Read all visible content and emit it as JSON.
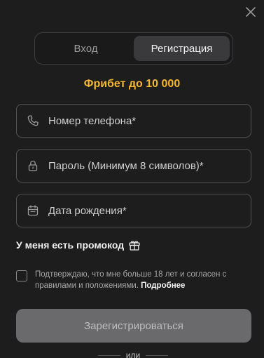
{
  "tabs": [
    {
      "label": "Вход",
      "active": false
    },
    {
      "label": "Регистрация",
      "active": true
    }
  ],
  "bonus": {
    "text": "Фрибет до 10 000",
    "color": "#f5b730"
  },
  "fields": {
    "phone": {
      "placeholder": "Номер телефона*",
      "icon": "phone-icon"
    },
    "password": {
      "placeholder": "Пароль (Минимум 8 символов)*",
      "icon": "lock-icon"
    },
    "birthdate": {
      "placeholder": "Дата рождения*",
      "icon": "calendar-icon"
    }
  },
  "promo": {
    "label": "У меня есть промокод",
    "icon": "gift-icon"
  },
  "agreement": {
    "text": "Подтверждаю, что мне больше 18 лет и согласен с правилами и положениями.",
    "link": "Подробнее",
    "checked": false
  },
  "submit": {
    "label": "Зарегистрироваться"
  },
  "divider": {
    "label": "или"
  },
  "close": {
    "icon": "close-icon"
  }
}
